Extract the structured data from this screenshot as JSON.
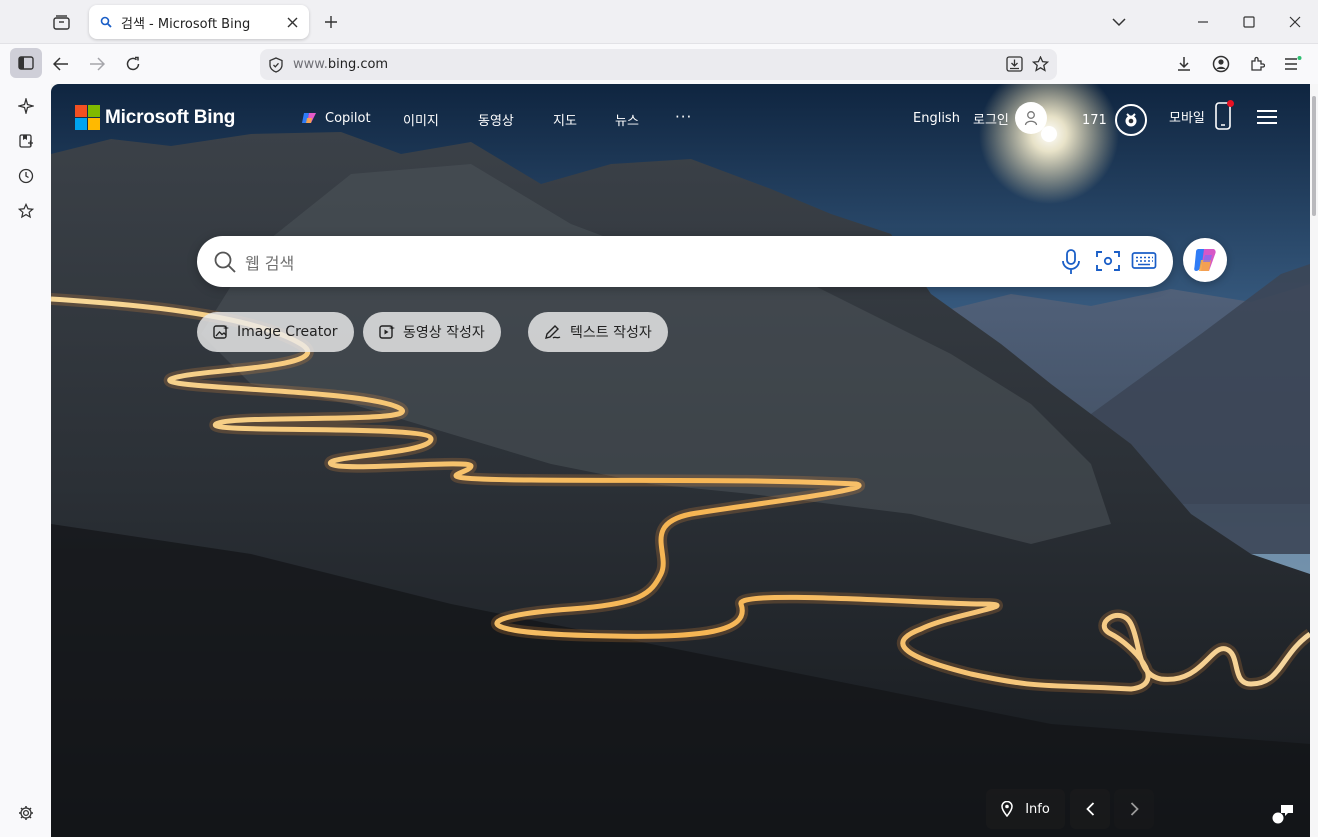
{
  "browser": {
    "tab": {
      "title": "검색 - Microsoft Bing"
    },
    "url": {
      "prefix": "www.",
      "domain": "bing.com"
    }
  },
  "bing": {
    "brand": "Microsoft Bing",
    "nav": [
      {
        "label": "Copilot"
      },
      {
        "label": "이미지"
      },
      {
        "label": "동영상"
      },
      {
        "label": "지도"
      },
      {
        "label": "뉴스"
      },
      {
        "label": "···"
      }
    ],
    "header": {
      "language": "English",
      "login": "로그인",
      "rewards_points": "171",
      "mobile": "모바일"
    },
    "search": {
      "placeholder": "웹 검색"
    },
    "creators": [
      {
        "label": "Image Creator"
      },
      {
        "label": "동영상 작성자"
      },
      {
        "label": "텍스트 작성자"
      }
    ],
    "footer": {
      "info": "Info"
    }
  },
  "colors": {
    "accent": "#0067b8",
    "badge_red": "#e81123",
    "ms_red": "#f25022",
    "ms_green": "#7fba00",
    "ms_blue": "#00a4ef",
    "ms_yellow": "#ffb900"
  },
  "icons": {
    "sidebar": [
      "sidebar-toggle-icon",
      "ai-sparkle-icon",
      "bookmarks-icon",
      "history-icon",
      "star-icon",
      "settings-icon"
    ],
    "toolbar": [
      "back-icon",
      "forward-icon",
      "reload-icon",
      "shield-icon",
      "install-app-icon",
      "bookmark-star-icon",
      "download-icon",
      "account-icon",
      "extensions-icon",
      "app-menu-icon"
    ]
  }
}
